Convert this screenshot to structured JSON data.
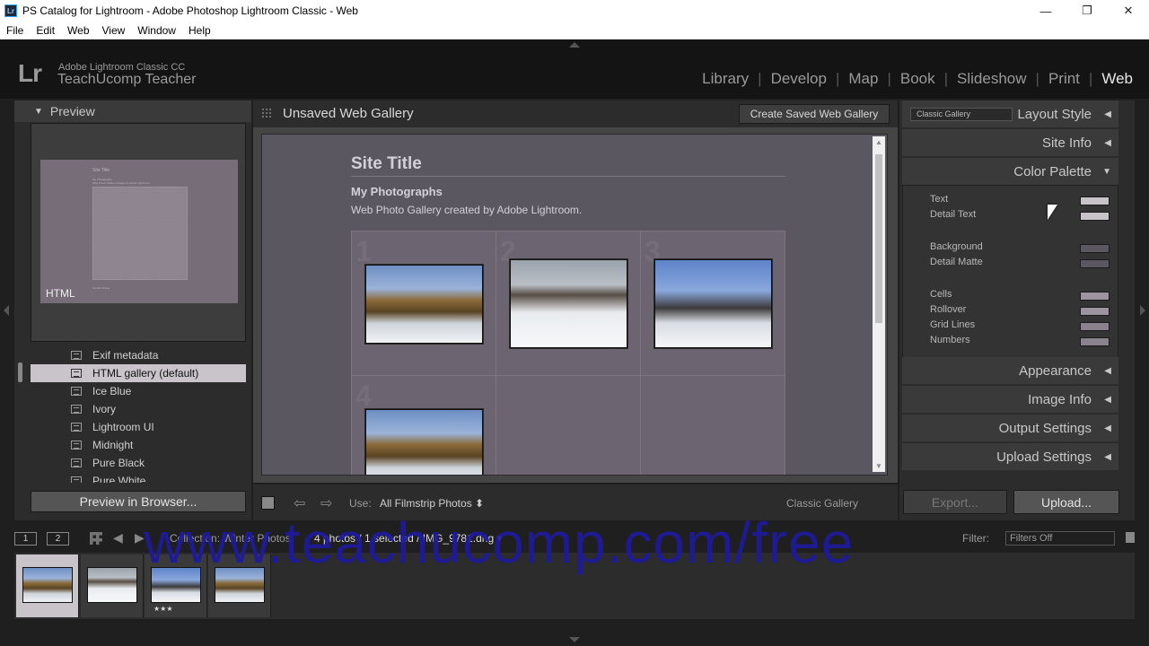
{
  "window": {
    "title": "PS Catalog for Lightroom - Adobe Photoshop Lightroom Classic - Web",
    "app_icon": "Lr",
    "minimize_glyph": "—",
    "restore_glyph": "❐",
    "close_glyph": "✕"
  },
  "menu": [
    "File",
    "Edit",
    "Web",
    "View",
    "Window",
    "Help"
  ],
  "identity": {
    "logo": "Lr",
    "line1": "Adobe Lightroom Classic CC",
    "line2": "TeachUcomp Teacher"
  },
  "modules": [
    "Library",
    "Develop",
    "Map",
    "Book",
    "Slideshow",
    "Print",
    "Web"
  ],
  "left_panel": {
    "preview_header": "Preview",
    "thumb": {
      "site_title": "Site Title",
      "sub1": "My Photographs",
      "sub2": "Web Photo Gallery created by Adobe Lightroom.",
      "footer": "Contact Name",
      "label": "HTML"
    },
    "templates": [
      {
        "label": "Exif metadata",
        "selected": false
      },
      {
        "label": "HTML gallery (default)",
        "selected": true
      },
      {
        "label": "Ice Blue",
        "selected": false
      },
      {
        "label": "Ivory",
        "selected": false
      },
      {
        "label": "Lightroom UI",
        "selected": false
      },
      {
        "label": "Midnight",
        "selected": false
      },
      {
        "label": "Pure Black",
        "selected": false
      },
      {
        "label": "Pure White",
        "selected": false
      }
    ],
    "preview_button": "Preview in Browser..."
  },
  "center": {
    "gallery_name": "Unsaved Web Gallery",
    "create_button": "Create Saved Web Gallery",
    "site_title": "Site Title",
    "collection_title": "My Photographs",
    "collection_desc": "Web Photo Gallery created by Adobe Lightroom.",
    "cell_numbers": [
      "1",
      "2",
      "3",
      "4"
    ],
    "toolbar": {
      "use_label": "Use:",
      "use_value": "All Filmstrip Photos ⬍",
      "gallery_type": "Classic Gallery"
    }
  },
  "right_panel": {
    "layout_select": "Classic Gallery",
    "sections": {
      "layout_style": "Layout Style",
      "site_info": "Site Info",
      "color_palette": "Color Palette",
      "appearance": "Appearance",
      "image_info": "Image Info",
      "output_settings": "Output Settings",
      "upload_settings": "Upload Settings"
    },
    "palette": [
      {
        "label": "Text",
        "color": "#c8c3c9"
      },
      {
        "label": "Detail Text",
        "color": "#c8c3c9"
      },
      {
        "label": "Background",
        "color": "#5b5760"
      },
      {
        "label": "Detail Matte",
        "color": "#5b5760"
      },
      {
        "label": "Cells",
        "color": "#9c949f"
      },
      {
        "label": "Rollover",
        "color": "#9c949f"
      },
      {
        "label": "Grid Lines",
        "color": "#8a828d"
      },
      {
        "label": "Numbers",
        "color": "#8a828d"
      }
    ],
    "export_button": "Export...",
    "upload_button": "Upload..."
  },
  "filmstrip": {
    "view1": "1",
    "view2": "2",
    "source": "Collection: Winter Photos",
    "count": "4 photos / 1 selected / IMG_9781.dng ▾",
    "filter_label": "Filter:",
    "filter_value": "Filters Off",
    "frames": [
      {
        "selected": true,
        "stars": ""
      },
      {
        "selected": false,
        "stars": ""
      },
      {
        "selected": false,
        "stars": "★★★"
      },
      {
        "selected": false,
        "stars": ""
      }
    ]
  },
  "watermark": "www.teachucomp.com/free"
}
